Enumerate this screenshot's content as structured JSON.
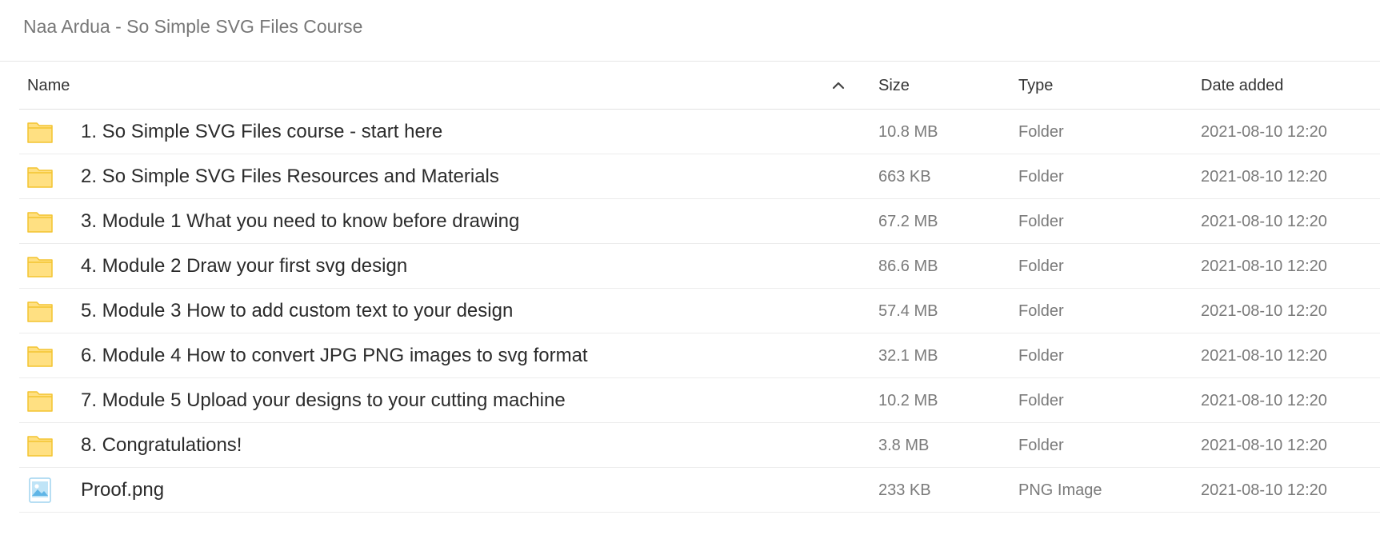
{
  "breadcrumb": {
    "path": "Naa Ardua - So Simple SVG Files Course"
  },
  "table": {
    "columns": {
      "name": "Name",
      "size": "Size",
      "type": "Type",
      "date": "Date added"
    },
    "sort": {
      "column": "name",
      "direction": "ascending",
      "icon": "chevron-up-icon"
    },
    "rows": [
      {
        "name": "1. So Simple SVG Files course - start here",
        "size": "10.8 MB",
        "type": "Folder",
        "date": "2021-08-10 12:20",
        "icon": "folder-icon"
      },
      {
        "name": "2. So Simple SVG Files Resources and Materials",
        "size": "663 KB",
        "type": "Folder",
        "date": "2021-08-10 12:20",
        "icon": "folder-icon"
      },
      {
        "name": "3. Module 1 What you need to know before drawing",
        "size": "67.2 MB",
        "type": "Folder",
        "date": "2021-08-10 12:20",
        "icon": "folder-icon"
      },
      {
        "name": "4. Module 2 Draw your first svg design",
        "size": "86.6 MB",
        "type": "Folder",
        "date": "2021-08-10 12:20",
        "icon": "folder-icon"
      },
      {
        "name": "5. Module 3 How to add custom text to your design",
        "size": "57.4 MB",
        "type": "Folder",
        "date": "2021-08-10 12:20",
        "icon": "folder-icon"
      },
      {
        "name": "6. Module 4 How to convert JPG PNG images to svg format",
        "size": "32.1 MB",
        "type": "Folder",
        "date": "2021-08-10 12:20",
        "icon": "folder-icon"
      },
      {
        "name": "7. Module 5 Upload your designs to your cutting machine",
        "size": "10.2 MB",
        "type": "Folder",
        "date": "2021-08-10 12:20",
        "icon": "folder-icon"
      },
      {
        "name": "8. Congratulations!",
        "size": "3.8 MB",
        "type": "Folder",
        "date": "2021-08-10 12:20",
        "icon": "folder-icon"
      },
      {
        "name": "Proof.png",
        "size": "233 KB",
        "type": "PNG Image",
        "date": "2021-08-10 12:20",
        "icon": "image-file-icon"
      }
    ]
  },
  "colors": {
    "folder_fill": "#FFE082",
    "folder_stroke": "#F4C430",
    "image_blue": "#7EC8F0",
    "divider": "#ECECEC"
  }
}
